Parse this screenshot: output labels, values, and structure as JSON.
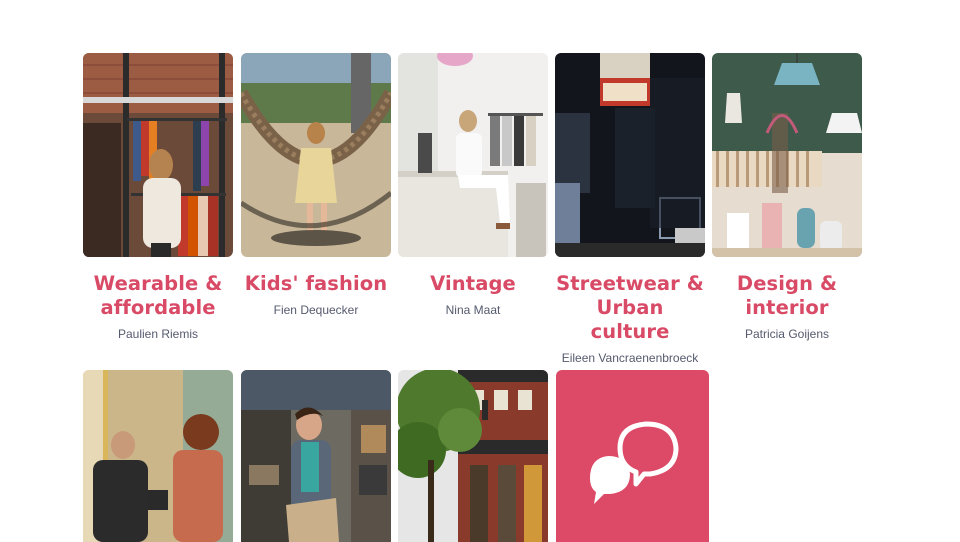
{
  "cards": [
    {
      "title_line1": "Wearable &",
      "title_line2": "affordable",
      "author": "Paulien Riemis",
      "image": "woman browsing clothing rack in shop"
    },
    {
      "title_line1": "Kids' fashion",
      "title_line2": "",
      "author": "Fien Dequecker",
      "image": "child on rope swing in playground"
    },
    {
      "title_line1": "Vintage",
      "title_line2": "",
      "author": "Nina Maat",
      "image": "woman seated on counter in white boutique"
    },
    {
      "title_line1": "Streetwear &",
      "title_line2": "Urban culture",
      "author": "Eileen Vancraenenbroeck",
      "image": "Lockwood shop window at night"
    },
    {
      "title_line1": "Design &",
      "title_line2": "interior",
      "author": "Patricia Goijens",
      "image": "interior design shop with vases and lamps"
    }
  ],
  "row2": [
    {
      "image": "two people talking in a shop"
    },
    {
      "image": "smiling woman in bag shop"
    },
    {
      "image": "historic corner building with storefronts"
    }
  ],
  "speech_tile": {
    "icon": "speech-bubbles-icon",
    "color": "#dd4a67"
  },
  "colors": {
    "accent": "#d84a66",
    "author": "#555a6e"
  }
}
